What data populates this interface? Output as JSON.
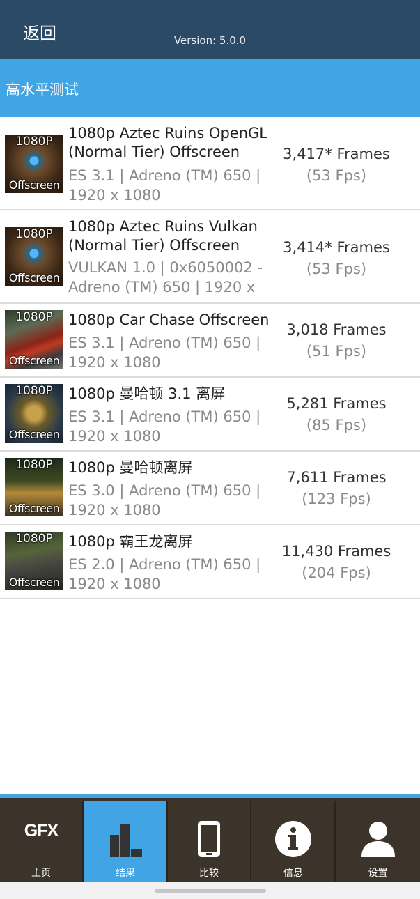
{
  "header": {
    "back_label": "返回",
    "version": "Version: 5.0.0"
  },
  "section": {
    "title": "高水平测试"
  },
  "results": [
    {
      "badge_top": "1080P",
      "badge_bottom": "Offscreen",
      "thumb": "aztec",
      "title_1": "1080p Aztec Ruins OpenGL",
      "title_2": "(Normal Tier) Offscreen",
      "sub_1": "ES 3.1 | Adreno (TM) 650 |",
      "sub_2": "1920 x 1080",
      "score": "3,417* Frames",
      "fps": "(53 Fps)"
    },
    {
      "badge_top": "1080P",
      "badge_bottom": "Offscreen",
      "thumb": "aztec",
      "title_1": "1080p Aztec Ruins Vulkan",
      "title_2": "(Normal Tier) Offscreen",
      "sub_1": "VULKAN 1.0 | 0x6050002 -",
      "sub_2": "Adreno (TM) 650 | 1920 x",
      "score": "3,414* Frames",
      "fps": "(53 Fps)"
    },
    {
      "badge_top": "1080P",
      "badge_bottom": "Offscreen",
      "thumb": "car",
      "title_1": "1080p Car Chase Offscreen",
      "title_2": "",
      "sub_1": "ES 3.1 | Adreno (TM) 650 |",
      "sub_2": "1920 x 1080",
      "score": "3,018 Frames",
      "fps": "(51 Fps)"
    },
    {
      "badge_top": "1080P",
      "badge_bottom": "Offscreen",
      "thumb": "manhattan31",
      "title_1": "1080p 曼哈顿 3.1 离屏",
      "title_2": "",
      "sub_1": "ES 3.1 | Adreno (TM) 650 |",
      "sub_2": "1920 x 1080",
      "score": "5,281 Frames",
      "fps": "(85 Fps)"
    },
    {
      "badge_top": "1080P",
      "badge_bottom": "Offscreen",
      "thumb": "manhattan",
      "title_1": "1080p 曼哈顿离屏",
      "title_2": "",
      "sub_1": "ES 3.0 | Adreno (TM) 650 |",
      "sub_2": "1920 x 1080",
      "score": "7,611 Frames",
      "fps": "(123 Fps)"
    },
    {
      "badge_top": "1080P",
      "badge_bottom": "Offscreen",
      "thumb": "trex",
      "title_1": "1080p 霸王龙离屏",
      "title_2": "",
      "sub_1": "ES 2.0 | Adreno (TM) 650 |",
      "sub_2": "1920 x 1080",
      "score": "11,430 Frames",
      "fps": "(204 Fps)"
    }
  ],
  "tabs": [
    {
      "label": "主页",
      "icon": "gfx-logo-icon",
      "icon_text": "GFX",
      "active": false
    },
    {
      "label": "结果",
      "icon": "bar-chart-icon",
      "active": true
    },
    {
      "label": "比较",
      "icon": "phone-icon",
      "active": false
    },
    {
      "label": "信息",
      "icon": "info-icon",
      "active": false
    },
    {
      "label": "设置",
      "icon": "user-icon",
      "active": false
    }
  ],
  "colors": {
    "header": "#2b4a66",
    "accent": "#41a4e4",
    "tabbar": "#3c342b"
  }
}
